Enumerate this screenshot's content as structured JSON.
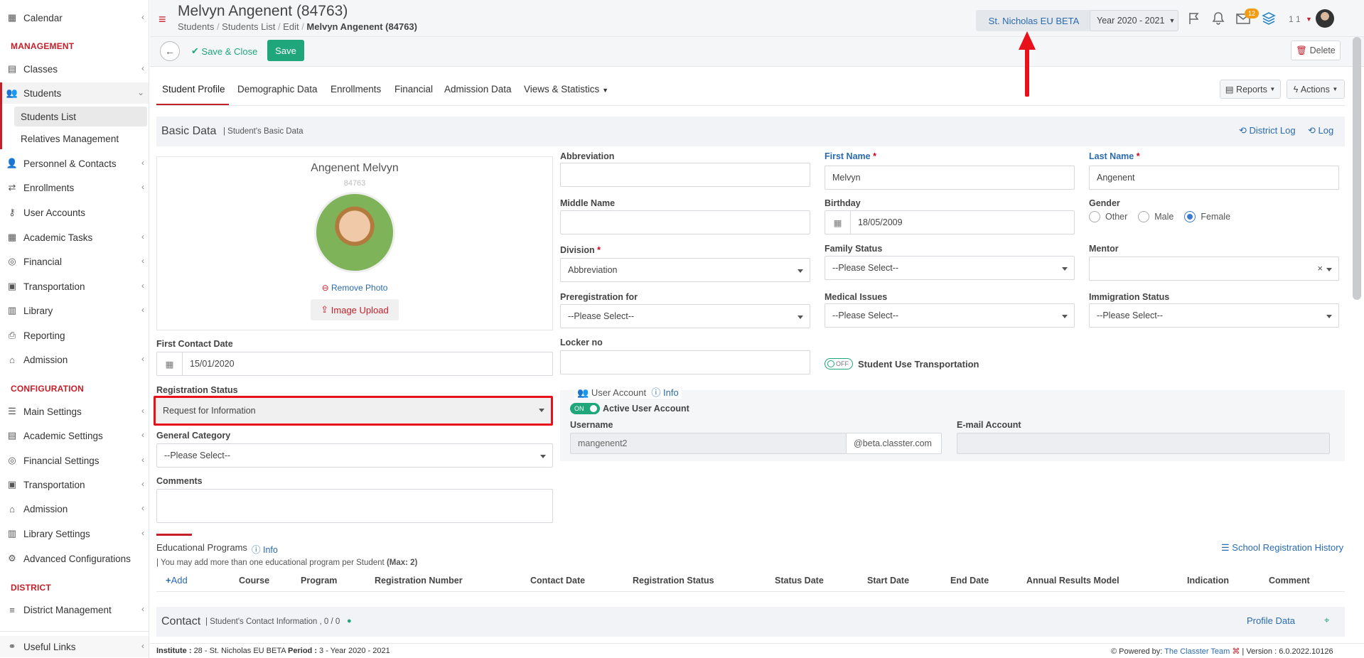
{
  "sidebar": {
    "items": [
      {
        "label": "Calendar",
        "icon": "calendar-icon"
      },
      {
        "label": "Classes",
        "icon": "classes-icon"
      },
      {
        "label": "Students",
        "icon": "students-icon"
      },
      {
        "label": "Personnel & Contacts",
        "icon": "personnel-icon"
      },
      {
        "label": "Enrollments",
        "icon": "enrollments-icon"
      },
      {
        "label": "User Accounts",
        "icon": "key-icon"
      },
      {
        "label": "Academic Tasks",
        "icon": "tasks-icon"
      },
      {
        "label": "Financial",
        "icon": "financial-icon"
      },
      {
        "label": "Transportation",
        "icon": "bus-icon"
      },
      {
        "label": "Library",
        "icon": "library-icon"
      },
      {
        "label": "Reporting",
        "icon": "printer-icon"
      },
      {
        "label": "Admission",
        "icon": "institution-icon"
      },
      {
        "label": "Main Settings",
        "icon": "sliders-icon"
      },
      {
        "label": "Academic Settings",
        "icon": "academic-settings-icon"
      },
      {
        "label": "Financial Settings",
        "icon": "financial-icon"
      },
      {
        "label": "Transportation",
        "icon": "bus-icon"
      },
      {
        "label": "Admission",
        "icon": "institution-icon"
      },
      {
        "label": "Library Settings",
        "icon": "library-icon"
      },
      {
        "label": "Advanced Configurations",
        "icon": "gears-icon"
      },
      {
        "label": "District Management",
        "icon": "menu-icon"
      },
      {
        "label": "Useful Links",
        "icon": "link-icon"
      }
    ],
    "headings": {
      "management": "MANAGEMENT",
      "configuration": "CONFIGURATION",
      "district": "DISTRICT"
    },
    "students_sub": [
      "Students List",
      "Relatives Management"
    ]
  },
  "header": {
    "title": "Melvyn Angenent (84763)",
    "breadcrumb": [
      "Students",
      "Students List",
      "Edit",
      "Melvyn Angenent (84763)"
    ],
    "school_button": "St. Nicholas EU BETA",
    "year_select": "Year 2020 - 2021",
    "mail_badge": "12",
    "user_count": "1 1"
  },
  "toolbar": {
    "save_close": "Save & Close",
    "save": "Save",
    "delete": "Delete"
  },
  "tabs": [
    "Student Profile",
    "Demographic Data",
    "Enrollments",
    "Financial",
    "Admission Data",
    "Views & Statistics"
  ],
  "top_actions": {
    "reports": "Reports",
    "actions": "Actions"
  },
  "basic": {
    "title": "Basic Data",
    "subtitle": "| Student's Basic Data",
    "district_log": "District Log",
    "log": "Log",
    "photo_name": "Angenent Melvyn",
    "photo_id": "84763",
    "remove_photo": "Remove Photo",
    "image_upload": "Image Upload",
    "first_contact_label": "First Contact Date",
    "first_contact_value": "15/01/2020",
    "registration_label": "Registration Status",
    "registration_value": "Request for Information",
    "general_category_label": "General Category",
    "general_category_value": "--Please Select--",
    "comments_label": "Comments",
    "abbreviation_label": "Abbreviation",
    "first_name_label": "First Name",
    "first_name_value": "Melvyn",
    "last_name_label": "Last Name",
    "last_name_value": "Angenent",
    "middle_name_label": "Middle Name",
    "birthday_label": "Birthday",
    "birthday_value": "18/05/2009",
    "gender_label": "Gender",
    "gender_options": [
      "Other",
      "Male",
      "Female"
    ],
    "division_label": "Division",
    "division_value": "Abbreviation",
    "family_status_label": "Family Status",
    "family_status_value": "--Please Select--",
    "mentor_label": "Mentor",
    "mentor_clear": "×",
    "preregistration_label": "Preregistration for",
    "preregistration_value": "--Please Select--",
    "medical_label": "Medical Issues",
    "medical_value": "--Please Select--",
    "immigration_label": "Immigration Status",
    "immigration_value": "--Please Select--",
    "locker_label": "Locker no",
    "transport_toggle": "OFF",
    "transport_label": "Student Use Transportation",
    "user_account_label": "User Account",
    "user_account_info": "Info",
    "active_toggle": "ON",
    "active_label": "Active User Account",
    "username_label": "Username",
    "username_value": "mangenent2",
    "username_domain": "@beta.classter.com",
    "email_label": "E-mail Account"
  },
  "programs": {
    "title": "Educational Programs",
    "info": "Info",
    "note": "| You may add more than one educational program per Student",
    "note_max": "(Max: 2)",
    "history": "School Registration History",
    "add": "Add",
    "columns": [
      "Course",
      "Program",
      "Registration Number",
      "Contact Date",
      "Registration Status",
      "Status Date",
      "Start Date",
      "End Date",
      "Annual Results Model",
      "Indication",
      "Comment"
    ]
  },
  "contact": {
    "title": "Contact",
    "subtitle": "| Student's Contact Information , 0 / 0",
    "profile_data": "Profile Data"
  },
  "footer": {
    "left_label1": "Institute :",
    "left_val1": "28 - St. Nicholas EU BETA",
    "left_label2": "Period :",
    "left_val2": "3 - Year 2020 - 2021",
    "powered": "Powered by:",
    "team": "The Classter Team",
    "version": "| Version : 6.0.2022.10126"
  },
  "colors": {
    "accent_green": "#1fa67a",
    "brand_red": "#c3202a",
    "link_blue": "#2a6bb0",
    "annotation_red": "#e8101a"
  }
}
